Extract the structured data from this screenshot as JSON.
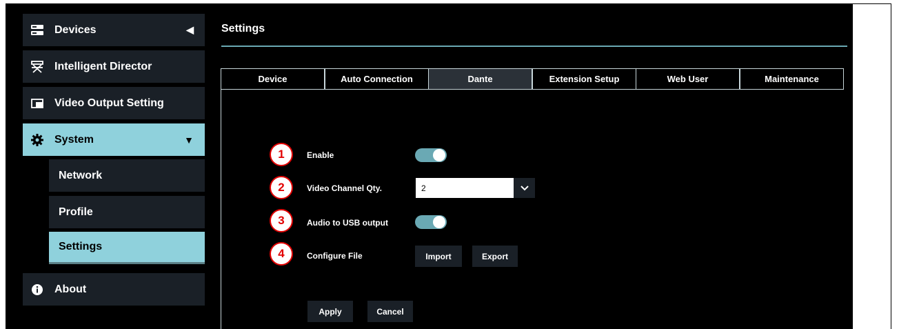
{
  "sidebar": {
    "items": [
      {
        "label": "Devices",
        "icon": "devices-icon",
        "arrow": "◀"
      },
      {
        "label": "Intelligent Director",
        "icon": "director-chair-icon"
      },
      {
        "label": "Video Output Setting",
        "icon": "video-output-icon"
      },
      {
        "label": "System",
        "icon": "gear-icon",
        "arrow": "▼"
      },
      {
        "label": "About",
        "icon": "info-icon"
      }
    ],
    "subitems": [
      {
        "label": "Network"
      },
      {
        "label": "Profile"
      },
      {
        "label": "Settings"
      }
    ]
  },
  "page": {
    "title": "Settings"
  },
  "tabs": [
    "Device",
    "Auto Connection",
    "Dante",
    "Extension Setup",
    "Web User",
    "Maintenance"
  ],
  "active_tab": "Dante",
  "form": {
    "badges": [
      "1",
      "2",
      "3",
      "4"
    ],
    "enable_label": "Enable",
    "video_channel_label": "Video Channel Qty.",
    "video_channel_value": "2",
    "audio_usb_label": "Audio to USB output",
    "configure_label": "Configure File",
    "import_label": "Import",
    "export_label": "Export",
    "apply_label": "Apply",
    "cancel_label": "Cancel"
  },
  "colors": {
    "accent": "#8fd1dc",
    "toggle_on": "#6aa9b4",
    "panel": "#1a2027",
    "badge_red": "#e20000"
  }
}
